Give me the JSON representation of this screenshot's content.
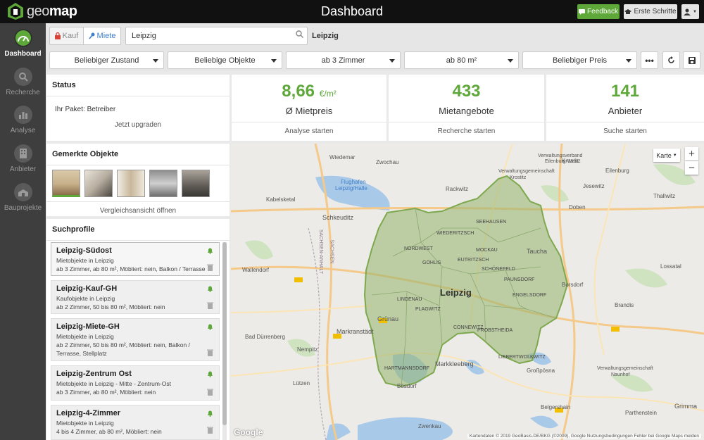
{
  "app": {
    "logo_text": "geomap",
    "title": "Dashboard"
  },
  "topbar": {
    "feedback_label": "Feedback",
    "first_steps_label": "Erste Schritte"
  },
  "sidebar": {
    "items": [
      {
        "label": "Dashboard",
        "icon": "gauge-icon",
        "active": true
      },
      {
        "label": "Recherche",
        "icon": "search-icon",
        "active": false
      },
      {
        "label": "Analyse",
        "icon": "bar-chart-icon",
        "active": false
      },
      {
        "label": "Anbieter",
        "icon": "building-icon",
        "active": false
      },
      {
        "label": "Bauprojekte",
        "icon": "crane-icon",
        "active": false
      }
    ]
  },
  "search": {
    "kauf_label": "Kauf",
    "miete_label": "Miete",
    "value": "Leipzig",
    "city_label": "Leipzig"
  },
  "filters": {
    "zustand": "Beliebiger Zustand",
    "objekte": "Beliebige Objekte",
    "zimmer": "ab 3 Zimmer",
    "flaeche": "ab 80 m²",
    "preis": "Beliebiger Preis"
  },
  "status": {
    "title": "Status",
    "paket": "Ihr Paket: Betreiber",
    "upgrade": "Jetzt upgraden"
  },
  "stats": [
    {
      "value": "8,66",
      "unit": "€/m²",
      "label": "Ø Mietpreis",
      "link": "Analyse starten"
    },
    {
      "value": "433",
      "unit": "",
      "label": "Mietangebote",
      "link": "Recherche starten"
    },
    {
      "value": "141",
      "unit": "",
      "label": "Anbieter",
      "link": "Suche starten"
    }
  ],
  "gemerkt": {
    "title": "Gemerkte Objekte",
    "compare": "Vergleichsansicht öffnen"
  },
  "suchprofile": {
    "title": "Suchprofile",
    "items": [
      {
        "title": "Leipzig-Südost",
        "line1": "Mietobjekte in Leipzig",
        "line2": "ab 3 Zimmer, ab 80 m², Möbliert: nein, Balkon / Terrasse"
      },
      {
        "title": "Leipzig-Kauf-GH",
        "line1": "Kaufobjekte in Leipzig",
        "line2": "ab 2 Zimmer, 50 bis 80 m², Möbliert: nein"
      },
      {
        "title": "Leipzig-Miete-GH",
        "line1": "Mietobjekte in Leipzig",
        "line2": "ab 2 Zimmer, 50 bis 80 m², Möbliert: nein, Balkon /",
        "line3": "Terrasse, Stellplatz"
      },
      {
        "title": "Leipzig-Zentrum Ost",
        "line1": "Mietobjekte in Leipzig - Mitte - Zentrum-Ost",
        "line2": "ab 3 Zimmer, ab 80 m², Möbliert: nein"
      },
      {
        "title": "Leipzig-4-Zimmer",
        "line1": "Mietobjekte in Leipzig",
        "line2": "4 bis 4 Zimmer, ab 80 m², Möbliert: nein"
      }
    ]
  },
  "map": {
    "type_label": "Karte",
    "city": "Leipzig",
    "attribution": "Kartendaten © 2019 GeoBasis-DE/BKG (©2009), Google   Nutzungsbedingungen   Fehler bei Google Maps melden",
    "google": "Google",
    "places": {
      "wiedemar": "Wiedemar",
      "zwochau": "Zwochau",
      "krostitz": "Krostitz",
      "eilenburg": "Eilenburg",
      "vv": "Verwaltungsverband",
      "eilenburg_west": "Eilenburg-West",
      "vg": "Verwaltungsgemeinschaft",
      "krostitz2": "Krostitz",
      "flughafen": "Flughafen",
      "flughafen2": "Leipzig/Halle",
      "rackwitz": "Rackwitz",
      "kabelsketal": "Kabelsketal",
      "schkeuditz": "Schkeuditz",
      "taucha": "Taucha",
      "wallendorf": "Wallendorf",
      "grunau": "Grünau",
      "markranstadt": "Markranstädt",
      "borsdorf": "Borsdorf",
      "brandis": "Brandis",
      "bad_durrenberg": "Bad Dürrenberg",
      "nempitz": "Nempitz",
      "markkleeberg": "Markkleeberg",
      "grossposna": "Großpösna",
      "lutzen": "Lützen",
      "bosdorf": "Bösdorf",
      "zwenkau": "Zwenkau",
      "grimma": "Grimma",
      "belgershain": "Belgershain",
      "parthenstein": "Parthenstein",
      "jesewitz": "Jesewitz",
      "lossatal": "Lossatal",
      "thallwitz": "Thallwitz",
      "doben": "Doben",
      "nordwest": "NORDWEST",
      "eutritzsch": "EUTRITZSCH",
      "schonefeld": "SCHÖNEFELD",
      "paunsdorf": "PAUNSDORF",
      "engelsdorf": "ENGELSDORF",
      "connewitz": "CONNEWITZ",
      "probstheida": "PROBSTHEIDA",
      "lindenau": "LINDENAU",
      "plagwitz": "PLAGWITZ",
      "liebertwolkwitz": "LIEBERTWOLKWITZ",
      "seehausen": "SEEHAUSEN",
      "wiederitzsch": "WIEDERITZSCH",
      "hartmannsdorf": "HARTMANNSDORF",
      "gohlis": "GOHLIS",
      "mockau": "MOCKAU",
      "sachsen": "SACHSEN",
      "sachsen_anhalt": "SACHSEN-ANHALT",
      "vg2": "Verwaltungsgemeinschaft",
      "naunhof": "Naunhof"
    }
  }
}
